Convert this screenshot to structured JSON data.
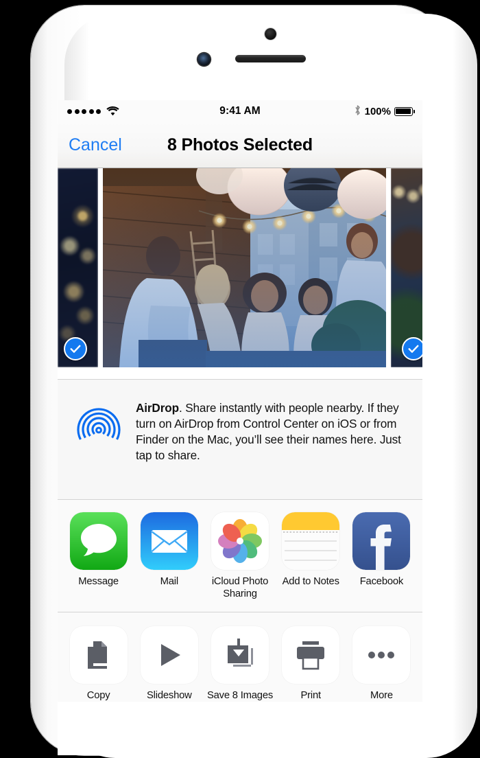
{
  "device": {
    "name": "iPhone",
    "hardware": {
      "proximity_sensor": "proximity-sensor",
      "front_camera": "front-camera",
      "earpiece": "earpiece-speaker",
      "silent_switch": "silent-switch",
      "volume_up": "volume-up-button",
      "volume_down": "volume-down-button",
      "power": "power-button"
    }
  },
  "status_bar": {
    "signal_dots": 5,
    "wifi_icon": "wifi-icon",
    "time": "9:41 AM",
    "bluetooth_icon": "bluetooth-icon",
    "battery_percent": "100%",
    "battery_icon": "battery-icon"
  },
  "nav_bar": {
    "cancel_label": "Cancel",
    "title": "8 Photos Selected",
    "cancel_color": "#1f7df3"
  },
  "photo_strip": {
    "selected_badge_color": "#1479ef",
    "thumbnails": [
      {
        "name": "photo-thumb-1",
        "kind": "night-lights",
        "selected": true,
        "badge_side": "left",
        "partial": true
      },
      {
        "name": "photo-thumb-2",
        "kind": "rooftop-party",
        "selected": false,
        "badge_side": "none",
        "partial": false
      },
      {
        "name": "photo-thumb-3",
        "kind": "person-string-lights",
        "selected": true,
        "badge_side": "right",
        "partial": true
      },
      {
        "name": "photo-thumb-4",
        "kind": "star-light",
        "selected": true,
        "badge_side": "right",
        "partial": true
      }
    ]
  },
  "airdrop": {
    "icon": "airdrop-icon",
    "icon_color": "#0a6cf0",
    "title": "AirDrop",
    "body": ". Share instantly with people nearby. If they turn on AirDrop from Control Center on iOS or from Finder on the Mac, you’ll see their names here. Just tap to share."
  },
  "app_row": [
    {
      "label": "Message",
      "icon": "messages-app-icon"
    },
    {
      "label": "Mail",
      "icon": "mail-app-icon"
    },
    {
      "label": "iCloud Photo Sharing",
      "icon": "photos-app-icon"
    },
    {
      "label": "Add to Notes",
      "icon": "notes-app-icon"
    },
    {
      "label": "Facebook",
      "icon": "facebook-app-icon"
    }
  ],
  "action_row": [
    {
      "label": "Copy",
      "icon": "copy-icon"
    },
    {
      "label": "Slideshow",
      "icon": "play-icon"
    },
    {
      "label": "Save 8 Images",
      "icon": "save-icon"
    },
    {
      "label": "Print",
      "icon": "printer-icon"
    },
    {
      "label": "More",
      "icon": "ellipsis-icon"
    }
  ]
}
